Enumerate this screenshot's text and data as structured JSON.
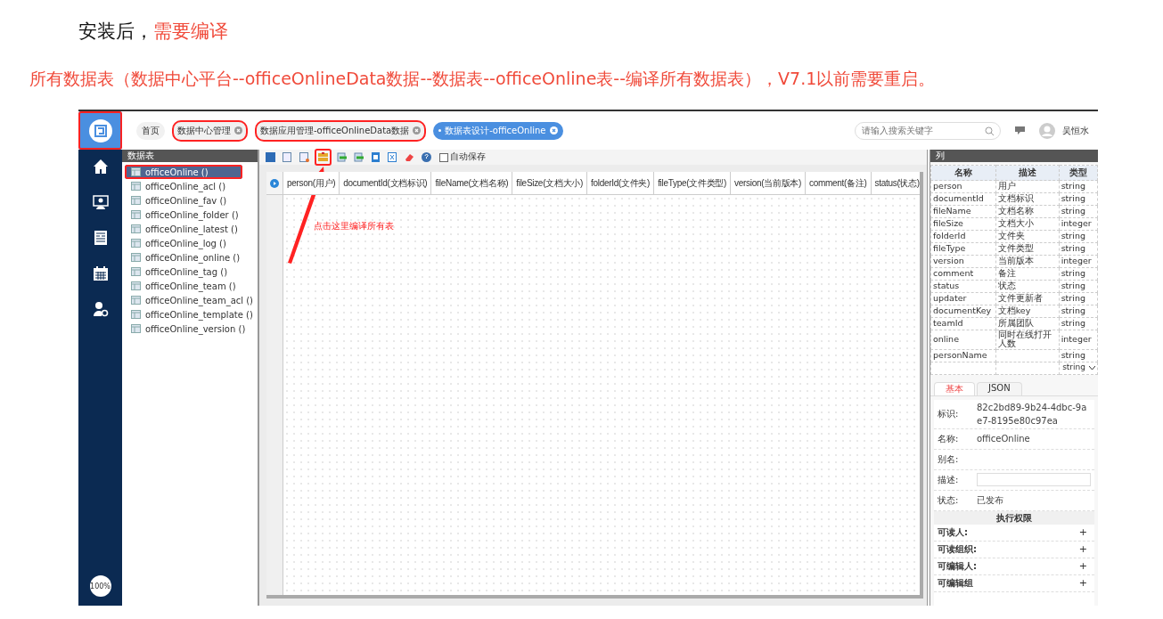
{
  "doc": {
    "heading": "安装后，",
    "heading_emphasis": "需要编译",
    "note": "所有数据表（数据中心平台--officeOnlineData数据--数据表--officeOnline表--编译所有数据表），V7.1以前需要重启。"
  },
  "app": {
    "logo_highlighted": true,
    "tabs": [
      {
        "label": "首页",
        "selected": false,
        "closable": false,
        "highlighted": false
      },
      {
        "label": "数据中心管理",
        "selected": false,
        "closable": true,
        "highlighted": true
      },
      {
        "label": "数据应用管理-officeOnlineData数据",
        "selected": false,
        "closable": true,
        "highlighted": true
      },
      {
        "label": "数据表设计-officeOnline",
        "selected": true,
        "closable": true,
        "highlighted": false
      }
    ],
    "search": {
      "placeholder": "请输入搜索关键字"
    },
    "user": "吴恒水",
    "zoom": "100%",
    "table_list": {
      "title": "数据表",
      "items": [
        {
          "label": "officeOnline ()",
          "selected": true,
          "highlighted": true
        },
        {
          "label": "officeOnline_acl ()",
          "selected": false,
          "highlighted": false
        },
        {
          "label": "officeOnline_fav ()",
          "selected": false,
          "highlighted": false
        },
        {
          "label": "officeOnline_folder ()",
          "selected": false,
          "highlighted": false
        },
        {
          "label": "officeOnline_latest ()",
          "selected": false,
          "highlighted": false
        },
        {
          "label": "officeOnline_log ()",
          "selected": false,
          "highlighted": false
        },
        {
          "label": "officeOnline_online ()",
          "selected": false,
          "highlighted": false
        },
        {
          "label": "officeOnline_tag ()",
          "selected": false,
          "highlighted": false
        },
        {
          "label": "officeOnline_team ()",
          "selected": false,
          "highlighted": false
        },
        {
          "label": "officeOnline_team_acl ()",
          "selected": false,
          "highlighted": false
        },
        {
          "label": "officeOnline_template ()",
          "selected": false,
          "highlighted": false
        },
        {
          "label": "officeOnline_version ()",
          "selected": false,
          "highlighted": false
        }
      ]
    },
    "toolbar": {
      "buttons": [
        {
          "kind": "save",
          "highlighted": false
        },
        {
          "kind": "table",
          "highlighted": false
        },
        {
          "kind": "table-edit",
          "highlighted": false
        },
        {
          "kind": "compile",
          "highlighted": true
        },
        {
          "kind": "import",
          "highlighted": false
        },
        {
          "kind": "export",
          "highlighted": false
        },
        {
          "kind": "document",
          "highlighted": false
        },
        {
          "kind": "excel",
          "highlighted": false
        },
        {
          "kind": "eraser",
          "highlighted": false
        },
        {
          "kind": "help",
          "highlighted": false
        }
      ],
      "autosave": {
        "label": "自动保存",
        "checked": false
      }
    },
    "grid_columns": [
      "person(用户)",
      "documentId(文档标识)",
      "fileName(文档名称)",
      "fileSize(文档大小)",
      "folderId(文件夹)",
      "fileType(文件类型)",
      "version(当前版本)",
      "comment(备注)",
      "status(状态)"
    ],
    "annotation": "点击这里编译所有表",
    "columns_panel": {
      "title": "列",
      "headers": [
        "名称",
        "描述",
        "类型"
      ],
      "rows": [
        [
          "person",
          "用户",
          "string"
        ],
        [
          "documentId",
          "文档标识",
          "string"
        ],
        [
          "fileName",
          "文档名称",
          "string"
        ],
        [
          "fileSize",
          "文档大小",
          "integer"
        ],
        [
          "folderId",
          "文件夹",
          "string"
        ],
        [
          "fileType",
          "文件类型",
          "string"
        ],
        [
          "version",
          "当前版本",
          "integer"
        ],
        [
          "comment",
          "备注",
          "string"
        ],
        [
          "status",
          "状态",
          "string"
        ],
        [
          "updater",
          "文件更新者",
          "string"
        ],
        [
          "documentKey",
          "文档key",
          "string"
        ],
        [
          "teamId",
          "所属团队",
          "string"
        ],
        [
          "online",
          "同时在线打开人数",
          "integer"
        ],
        [
          "personName",
          "",
          "string"
        ]
      ],
      "new_row_type": "string"
    },
    "props": {
      "tabs": [
        {
          "label": "基本",
          "selected": true
        },
        {
          "label": "JSON",
          "selected": false
        }
      ],
      "fields": [
        {
          "kind": "text",
          "label": "标识:",
          "value": "82c2bd89-9b24-4dbc-9ae7-8195e80c97ea"
        },
        {
          "kind": "text",
          "label": "名称:",
          "value": "officeOnline"
        },
        {
          "kind": "text",
          "label": "别名:"
        },
        {
          "kind": "input",
          "label": "描述:"
        },
        {
          "kind": "text",
          "label": "状态:",
          "value": "已发布"
        }
      ],
      "section": "执行权限",
      "permissions": [
        {
          "label": "可读人:",
          "action": "+"
        },
        {
          "label": "可读组织:",
          "action": "+"
        },
        {
          "label": "可编辑人:",
          "action": "+"
        },
        {
          "label": "可编辑组",
          "action": "+"
        }
      ]
    }
  }
}
